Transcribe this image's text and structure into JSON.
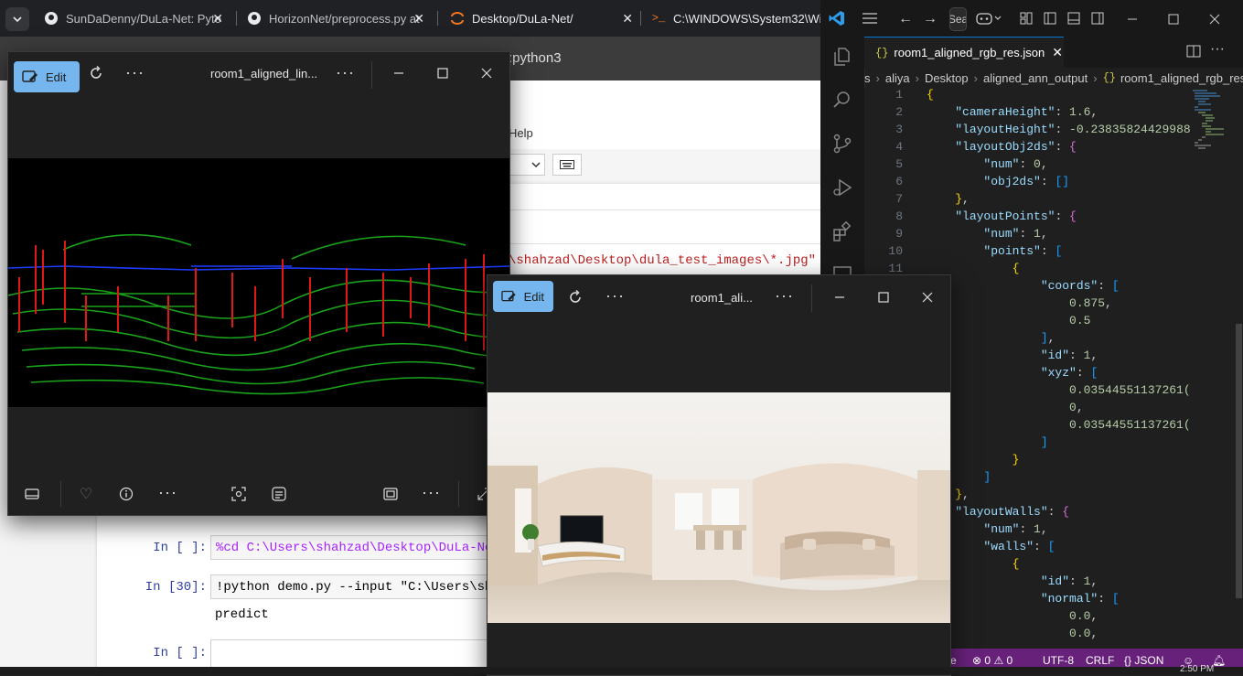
{
  "browser": {
    "tabs": [
      {
        "title": "SunDaDenny/DuLa-Net: Pyto",
        "icon": "github-icon"
      },
      {
        "title": "HorizonNet/preprocess.py at",
        "icon": "github-icon"
      },
      {
        "title": "Desktop/DuLa-Net/",
        "icon": "jupyter-icon"
      },
      {
        "title": "C:\\WINDOWS\\System32\\Win",
        "icon": "terminal-icon"
      }
    ]
  },
  "jupyter": {
    "kernel_text": ":python3",
    "menu_help": "Help",
    "cmd_fragment": "\\shahzad\\Desktop\\dula_test_images\\*.jpg\" --o",
    "cells": [
      {
        "prompt": "In [ ]:",
        "code": "%cd C:\\Users\\shahzad\\Desktop\\DuLa-Net"
      },
      {
        "prompt": "In [30]:",
        "code": "!python demo.py --input \"C:\\Users\\shahz",
        "output": "predict"
      },
      {
        "prompt": "In [ ]:",
        "code": ""
      }
    ]
  },
  "photos_back": {
    "edit_label": "Edit",
    "title": "room1_aligned_lin..."
  },
  "photos_front": {
    "edit_label": "Edit",
    "title": "room1_ali..."
  },
  "vscode": {
    "tab_label": "room1_aligned_rgb_res.json",
    "search_label": "Sea",
    "breadcrumb": [
      "s",
      "aliya",
      "Desktop",
      "aligned_ann_output",
      "room1_aligned_rgb_res"
    ],
    "lines": [
      {
        "n": "1",
        "text": "{"
      },
      {
        "n": "2",
        "text": "    \"cameraHeight\": 1.6,"
      },
      {
        "n": "3",
        "text": "    \"layoutHeight\": -0.23835824429988"
      },
      {
        "n": "4",
        "text": "    \"layoutObj2ds\": {"
      },
      {
        "n": "5",
        "text": "        \"num\": 0,"
      },
      {
        "n": "6",
        "text": "        \"obj2ds\": []"
      },
      {
        "n": "7",
        "text": "    },"
      },
      {
        "n": "8",
        "text": "    \"layoutPoints\": {"
      },
      {
        "n": "9",
        "text": "        \"num\": 1,"
      },
      {
        "n": "10",
        "text": "        \"points\": ["
      },
      {
        "n": "11",
        "text": "            {"
      },
      {
        "n": "",
        "text": "                \"coords\": ["
      },
      {
        "n": "",
        "text": "                    0.875,"
      },
      {
        "n": "",
        "text": "                    0.5"
      },
      {
        "n": "",
        "text": "                ],"
      },
      {
        "n": "",
        "text": "                \"id\": 1,"
      },
      {
        "n": "",
        "text": "                \"xyz\": ["
      },
      {
        "n": "",
        "text": "                    0.03544551137261("
      },
      {
        "n": "",
        "text": "                    0,"
      },
      {
        "n": "",
        "text": "                    0.03544551137261("
      },
      {
        "n": "",
        "text": "                ]"
      },
      {
        "n": "",
        "text": "            }"
      },
      {
        "n": "",
        "text": "        ]"
      },
      {
        "n": "",
        "text": "    },"
      },
      {
        "n": "",
        "text": "    \"layoutWalls\": {"
      },
      {
        "n": "",
        "text": "        \"num\": 1,"
      },
      {
        "n": "",
        "text": "        \"walls\": ["
      },
      {
        "n": "",
        "text": "            {"
      },
      {
        "n": "",
        "text": "                \"id\": 1,"
      },
      {
        "n": "",
        "text": "                \"normal\": ["
      },
      {
        "n": "",
        "text": "                    0.0,"
      },
      {
        "n": "",
        "text": "                    0.0,"
      }
    ],
    "status": {
      "left_char": "e",
      "errors": "0",
      "warnings": "0",
      "encoding": "UTF-8",
      "eol": "CRLF",
      "language": "JSON"
    }
  },
  "clock": "2:50 PM"
}
